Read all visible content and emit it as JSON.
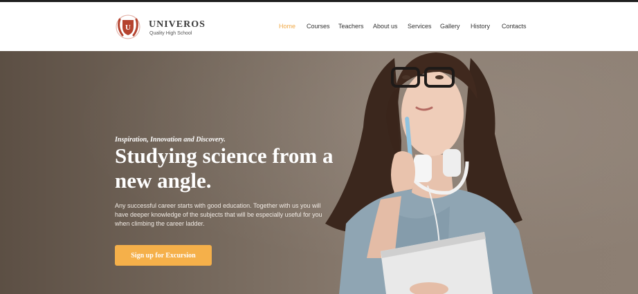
{
  "brand": {
    "name": "UNIVEROS",
    "tagline": "Quality High School",
    "logo_icon": "shield-laurel-icon",
    "logo_letter": "U"
  },
  "nav": {
    "items": [
      {
        "label": "Home",
        "active": true
      },
      {
        "label": "Courses",
        "active": false
      },
      {
        "label": "Teachers",
        "active": false
      },
      {
        "label": "About us",
        "active": false
      },
      {
        "label": "Services",
        "active": false
      },
      {
        "label": "Gallery",
        "active": false
      },
      {
        "label": "History",
        "active": false
      },
      {
        "label": "Contacts",
        "active": false
      }
    ]
  },
  "hero": {
    "eyebrow": "Inspiration, Innovation and Discovery.",
    "headline": "Studying science from a new angle.",
    "lead": "Any successful career starts with good education. Together with us you will have deeper knowledge of the subjects that will be especially useful for you when climbing the career ladder.",
    "cta_label": "Sign up for Excursion"
  },
  "colors": {
    "accent": "#f5b04a",
    "nav_active": "#f0a947",
    "logo": "#b5432f",
    "text_dark": "#333333"
  }
}
